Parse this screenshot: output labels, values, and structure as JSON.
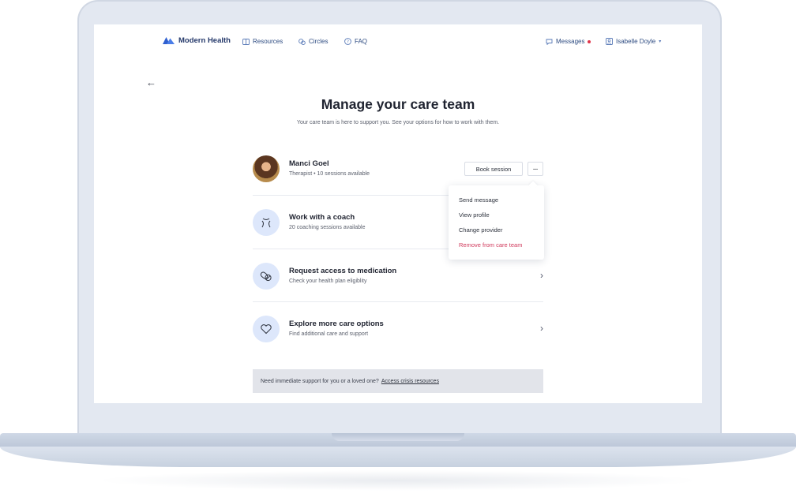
{
  "nav": {
    "brand": "Modern Health",
    "links": [
      {
        "label": "Resources",
        "icon": "book-icon"
      },
      {
        "label": "Circles",
        "icon": "chat-bubbles-icon"
      },
      {
        "label": "FAQ",
        "icon": "question-circle-icon"
      }
    ],
    "messages": "Messages",
    "user": "Isabelle Doyle",
    "accent_color": "#2c4a80",
    "notification_color": "#e0344a"
  },
  "page": {
    "title": "Manage your care team",
    "subtitle": "Your care team is here to support you. See your options for how to work with them."
  },
  "provider": {
    "name": "Manci Goel",
    "details": "Therapist • 10 sessions available",
    "book_label": "Book session",
    "more_label": "···"
  },
  "menu": {
    "items": [
      "Send message",
      "View profile",
      "Change provider",
      "Remove from care team"
    ],
    "danger_color": "#d03a5c"
  },
  "options": [
    {
      "title": "Work with a coach",
      "sub": "20 coaching sessions available",
      "icon": "coach-icon"
    },
    {
      "title": "Request access to medication",
      "sub": "Check your health plan eligiblity",
      "icon": "pill-icon"
    },
    {
      "title": "Explore more care options",
      "sub": "Find additional care and support",
      "icon": "heart-icon"
    }
  ],
  "crisis": {
    "text": "Need immediate support for you or a loved one?",
    "link": "Access crisis resources"
  }
}
